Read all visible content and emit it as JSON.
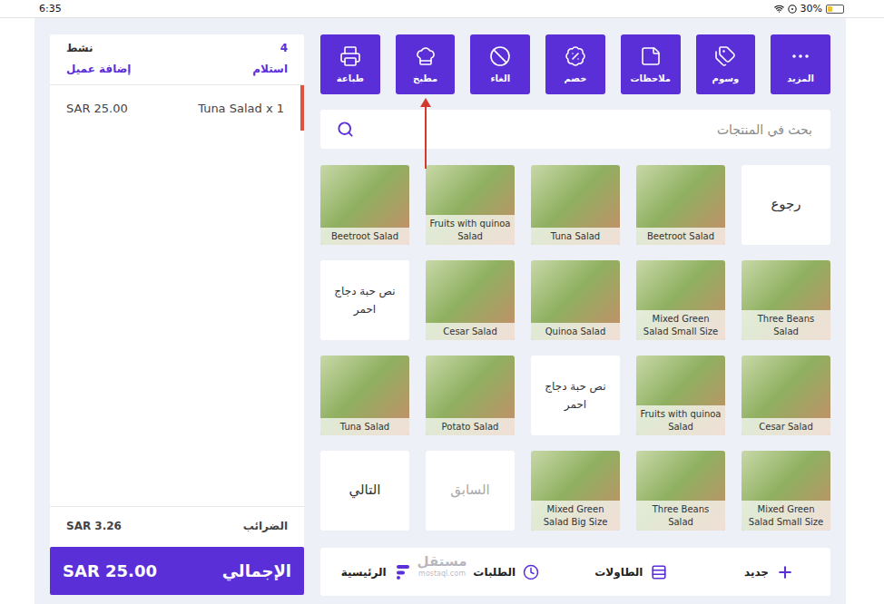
{
  "status_bar": {
    "time": "6:35",
    "battery": "30%",
    "battery_level": 0.3
  },
  "toolbar": [
    {
      "label": "المزيد"
    },
    {
      "label": "وسوم"
    },
    {
      "label": "ملاحظات"
    },
    {
      "label": "خصم"
    },
    {
      "label": "الغاء"
    },
    {
      "label": "مطبخ"
    },
    {
      "label": "طباعة"
    }
  ],
  "search": {
    "placeholder": "بحث في المنتجات"
  },
  "products": [
    {
      "label": "رجوع",
      "kind": "text",
      "disabled": false
    },
    {
      "label": "Beetroot Salad",
      "kind": "photo",
      "disabled": false
    },
    {
      "label": "Tuna Salad",
      "kind": "photo",
      "disabled": false
    },
    {
      "label": "Fruits with quinoa Salad",
      "kind": "photo",
      "disabled": false
    },
    {
      "label": "Beetroot Salad",
      "kind": "photo",
      "disabled": false
    },
    {
      "label": "Three Beans Salad",
      "kind": "photo",
      "disabled": false
    },
    {
      "label": "Mixed Green Salad Small Size",
      "kind": "photo",
      "disabled": false
    },
    {
      "label": "Quinoa Salad",
      "kind": "photo",
      "disabled": false
    },
    {
      "label": "Cesar Salad",
      "kind": "photo",
      "disabled": false
    },
    {
      "label": "نص حبة دجاج احمر",
      "kind": "text",
      "disabled": false
    },
    {
      "label": "Cesar Salad",
      "kind": "photo",
      "disabled": false
    },
    {
      "label": "Fruits with quinoa Salad",
      "kind": "photo",
      "disabled": false
    },
    {
      "label": "نص حبة دجاج احمر",
      "kind": "text",
      "disabled": false
    },
    {
      "label": "Potato Salad",
      "kind": "photo",
      "disabled": false
    },
    {
      "label": "Tuna Salad",
      "kind": "photo",
      "disabled": false
    },
    {
      "label": "Mixed Green Salad Small Size",
      "kind": "photo",
      "disabled": false
    },
    {
      "label": "Three Beans Salad",
      "kind": "photo",
      "disabled": false
    },
    {
      "label": "Mixed Green Salad Big Size",
      "kind": "photo",
      "disabled": false
    },
    {
      "label": "السابق",
      "kind": "text",
      "disabled": true
    },
    {
      "label": "التالي",
      "kind": "text",
      "disabled": false
    }
  ],
  "nav": [
    "جديد",
    "الطاولات",
    "الطلبات",
    "الرئيسية"
  ],
  "cart": {
    "count": "4",
    "status": "نشط",
    "order_type": "استلام",
    "add_customer": "إضافة عميل",
    "items": [
      {
        "label": "Tuna Salad x 1",
        "price": "SAR 25.00",
        "selected": true
      }
    ],
    "tax_label": "الضرائب",
    "tax": "SAR 3.26",
    "total_label": "الإجمالي",
    "total": "SAR 25.00"
  },
  "watermark": {
    "text": "مستقل",
    "url": "mostaql.com"
  }
}
